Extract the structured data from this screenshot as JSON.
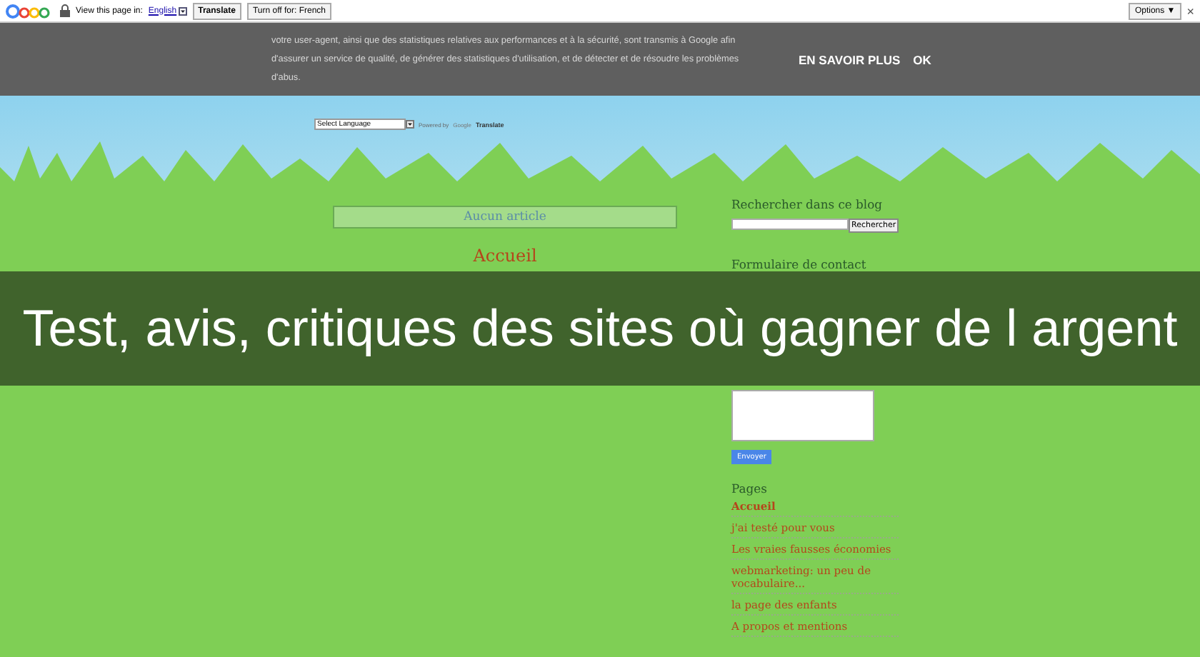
{
  "translate_bar": {
    "prompt": "View this page in:",
    "language": "English",
    "translate_button": "Translate",
    "turn_off_button": "Turn off for: French",
    "options_button": "Options ▼",
    "close": "×"
  },
  "cookie_notice": {
    "text": "votre user-agent, ainsi que des statistiques relatives aux performances et à la sécurité, sont transmis à Google afin d'assurer un service de qualité, de générer des statistiques d'utilisation, et de détecter et de résoudre les problèmes d'abus.",
    "learn_more": "EN SAVOIR PLUS",
    "ok": "OK"
  },
  "language_widget": {
    "select": "Select Language",
    "powered_by": "Powered by",
    "google": "Google",
    "translate": "Translate"
  },
  "main": {
    "notice": "Aucun article",
    "home_link": "Accueil"
  },
  "sidebar": {
    "search_title": "Rechercher dans ce blog",
    "search_button": "Rechercher",
    "contact_title": "Formulaire de contact",
    "send_button": "Envoyer",
    "pages_title": "Pages",
    "pages": [
      {
        "label": "Accueil",
        "selected": true
      },
      {
        "label": "j'ai testé pour vous",
        "selected": false
      },
      {
        "label": "Les vraies fausses économies",
        "selected": false
      },
      {
        "label": "webmarketing: un peu de vocabulaire...",
        "selected": false
      },
      {
        "label": "la page des enfants",
        "selected": false
      },
      {
        "label": "A propos et mentions",
        "selected": false
      }
    ]
  },
  "overlay_title": "Test, avis, critiques des sites où gagner de l argent"
}
